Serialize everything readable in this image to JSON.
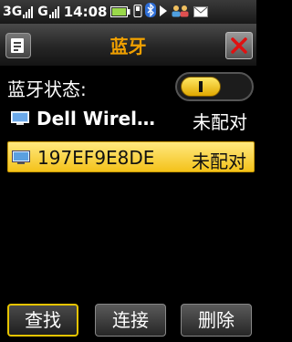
{
  "status_bar": {
    "network1": "3G",
    "network2": "G",
    "time": "14:08",
    "icons": [
      "battery-icon",
      "phone-icon",
      "bluetooth-icon",
      "play-icon",
      "contacts-icon",
      "mail-icon"
    ]
  },
  "header": {
    "title": "蓝牙"
  },
  "bluetooth": {
    "status_label": "蓝牙状态:",
    "enabled": true
  },
  "devices": [
    {
      "name": "Dell Wirel…",
      "state": "未配对",
      "selected": false
    },
    {
      "name": "197EF9E8DE",
      "state": "未配对",
      "selected": true
    }
  ],
  "buttons": {
    "search": "查找",
    "connect": "连接",
    "delete": "删除"
  },
  "colors": {
    "title": "#f0a000",
    "selection": "#f4c21a",
    "toggle_on": "#ffe866",
    "close_x": "#e01010"
  }
}
